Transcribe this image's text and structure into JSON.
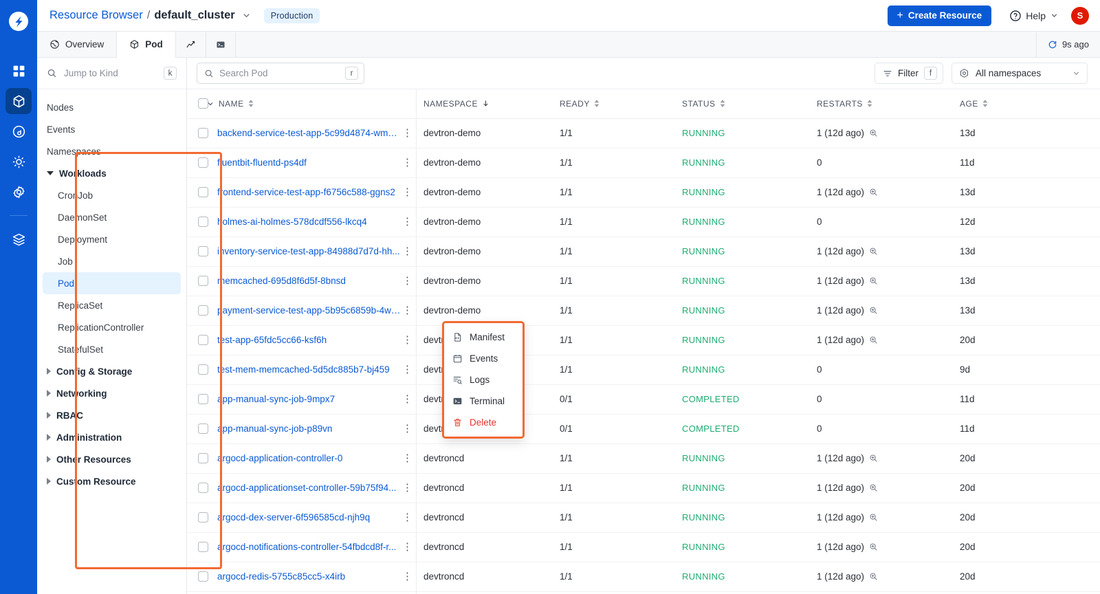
{
  "colors": {
    "brand": "#0b5ad4",
    "accent": "#f26a31",
    "success": "#1dad70",
    "danger": "#e5342b",
    "avatar": "#e11900"
  },
  "header": {
    "breadcrumb_root": "Resource Browser",
    "breadcrumb_sep": "/",
    "cluster_name": "default_cluster",
    "env_badge": "Production",
    "create_button": "Create Resource",
    "create_plus": "+",
    "help_label": "Help",
    "avatar_initial": "S"
  },
  "tabs": [
    {
      "label": "Overview",
      "icon": "globe-icon",
      "active": false
    },
    {
      "label": "Pod",
      "icon": "cube-icon",
      "active": true
    },
    {
      "label": "",
      "icon": "chart-icon",
      "active": false
    },
    {
      "label": "",
      "icon": "terminal-icon",
      "active": false
    }
  ],
  "refresh": {
    "label": "9s ago",
    "icon": "refresh-icon"
  },
  "sidebar": {
    "jump": {
      "placeholder": "Jump to Kind",
      "shortcut": "k",
      "icon": "search-icon"
    },
    "items": [
      {
        "label": "Nodes",
        "type": "item"
      },
      {
        "label": "Events",
        "type": "item"
      },
      {
        "label": "Namespaces",
        "type": "item"
      },
      {
        "label": "Workloads",
        "type": "group",
        "expanded": true
      },
      {
        "label": "CronJob",
        "type": "child"
      },
      {
        "label": "DaemonSet",
        "type": "child"
      },
      {
        "label": "Deployment",
        "type": "child"
      },
      {
        "label": "Job",
        "type": "child"
      },
      {
        "label": "Pod",
        "type": "child",
        "active": true
      },
      {
        "label": "ReplicaSet",
        "type": "child"
      },
      {
        "label": "ReplicationController",
        "type": "child"
      },
      {
        "label": "StatefulSet",
        "type": "child"
      },
      {
        "label": "Config & Storage",
        "type": "group",
        "expanded": false
      },
      {
        "label": "Networking",
        "type": "group",
        "expanded": false
      },
      {
        "label": "RBAC",
        "type": "group",
        "expanded": false
      },
      {
        "label": "Administration",
        "type": "group",
        "expanded": false
      },
      {
        "label": "Other Resources",
        "type": "group",
        "expanded": false
      },
      {
        "label": "Custom Resource",
        "type": "group",
        "expanded": false
      }
    ]
  },
  "toolbar": {
    "search_placeholder": "Search Pod",
    "search_shortcut": "r",
    "filter_label": "Filter",
    "filter_shortcut": "f",
    "namespace_value": "All namespaces"
  },
  "table": {
    "columns": [
      {
        "key": "name",
        "label": "NAME",
        "sort": "both"
      },
      {
        "key": "namespace",
        "label": "NAMESPACE",
        "sort": "desc"
      },
      {
        "key": "ready",
        "label": "READY",
        "sort": "both"
      },
      {
        "key": "status",
        "label": "STATUS",
        "sort": "both"
      },
      {
        "key": "restarts",
        "label": "RESTARTS",
        "sort": "both"
      },
      {
        "key": "age",
        "label": "AGE",
        "sort": "both"
      }
    ],
    "rows": [
      {
        "name": "backend-service-test-app-5c99d4874-wmm...",
        "namespace": "devtron-demo",
        "ready": "1/1",
        "status": "RUNNING",
        "restarts": "1 (12d ago)",
        "has_zoom": true,
        "age": "13d"
      },
      {
        "name": "fluentbit-fluentd-ps4df",
        "namespace": "devtron-demo",
        "ready": "1/1",
        "status": "RUNNING",
        "restarts": "0",
        "has_zoom": false,
        "age": "11d"
      },
      {
        "name": "frontend-service-test-app-f6756c588-ggns2",
        "namespace": "devtron-demo",
        "ready": "1/1",
        "status": "RUNNING",
        "restarts": "1 (12d ago)",
        "has_zoom": true,
        "age": "13d"
      },
      {
        "name": "holmes-ai-holmes-578dcdf556-lkcq4",
        "namespace": "devtron-demo",
        "ready": "1/1",
        "status": "RUNNING",
        "restarts": "0",
        "has_zoom": false,
        "age": "12d"
      },
      {
        "name": "inventory-service-test-app-84988d7d7d-hh...",
        "namespace": "devtron-demo",
        "ready": "1/1",
        "status": "RUNNING",
        "restarts": "1 (12d ago)",
        "has_zoom": true,
        "age": "13d"
      },
      {
        "name": "memcached-695d8f6d5f-8bnsd",
        "namespace": "devtron-demo",
        "ready": "1/1",
        "status": "RUNNING",
        "restarts": "1 (12d ago)",
        "has_zoom": true,
        "age": "13d"
      },
      {
        "name": "payment-service-test-app-5b95c6859b-4wx...",
        "namespace": "devtron-demo",
        "ready": "1/1",
        "status": "RUNNING",
        "restarts": "1 (12d ago)",
        "has_zoom": true,
        "age": "13d"
      },
      {
        "name": "test-app-65fdc5cc66-ksf6h",
        "namespace": "devtron-demo",
        "ready": "1/1",
        "status": "RUNNING",
        "restarts": "1 (12d ago)",
        "has_zoom": true,
        "age": "20d"
      },
      {
        "name": "test-mem-memcached-5d5dc885b7-bj459",
        "namespace": "devtron-demo",
        "ready": "1/1",
        "status": "RUNNING",
        "restarts": "0",
        "has_zoom": false,
        "age": "9d"
      },
      {
        "name": "app-manual-sync-job-9mpx7",
        "namespace": "devtroncd",
        "ready": "0/1",
        "status": "COMPLETED",
        "restarts": "0",
        "has_zoom": false,
        "age": "11d"
      },
      {
        "name": "app-manual-sync-job-p89vn",
        "namespace": "devtroncd",
        "ready": "0/1",
        "status": "COMPLETED",
        "restarts": "0",
        "has_zoom": false,
        "age": "11d"
      },
      {
        "name": "argocd-application-controller-0",
        "namespace": "devtroncd",
        "ready": "1/1",
        "status": "RUNNING",
        "restarts": "1 (12d ago)",
        "has_zoom": true,
        "age": "20d"
      },
      {
        "name": "argocd-applicationset-controller-59b75f94...",
        "namespace": "devtroncd",
        "ready": "1/1",
        "status": "RUNNING",
        "restarts": "1 (12d ago)",
        "has_zoom": true,
        "age": "20d"
      },
      {
        "name": "argocd-dex-server-6f596585cd-njh9q",
        "namespace": "devtroncd",
        "ready": "1/1",
        "status": "RUNNING",
        "restarts": "1 (12d ago)",
        "has_zoom": true,
        "age": "20d"
      },
      {
        "name": "argocd-notifications-controller-54fbdcd8f-r...",
        "namespace": "devtroncd",
        "ready": "1/1",
        "status": "RUNNING",
        "restarts": "1 (12d ago)",
        "has_zoom": true,
        "age": "20d"
      },
      {
        "name": "argocd-redis-5755c85cc5-x4irb",
        "namespace": "devtroncd",
        "ready": "1/1",
        "status": "RUNNING",
        "restarts": "1 (12d ago)",
        "has_zoom": true,
        "age": "20d"
      }
    ]
  },
  "context_menu": {
    "items": [
      {
        "label": "Manifest",
        "icon": "manifest-icon",
        "danger": false
      },
      {
        "label": "Events",
        "icon": "calendar-icon",
        "danger": false
      },
      {
        "label": "Logs",
        "icon": "logs-icon",
        "danger": false
      },
      {
        "label": "Terminal",
        "icon": "terminal-icon",
        "danger": false
      },
      {
        "label": "Delete",
        "icon": "trash-icon",
        "danger": true
      }
    ]
  }
}
